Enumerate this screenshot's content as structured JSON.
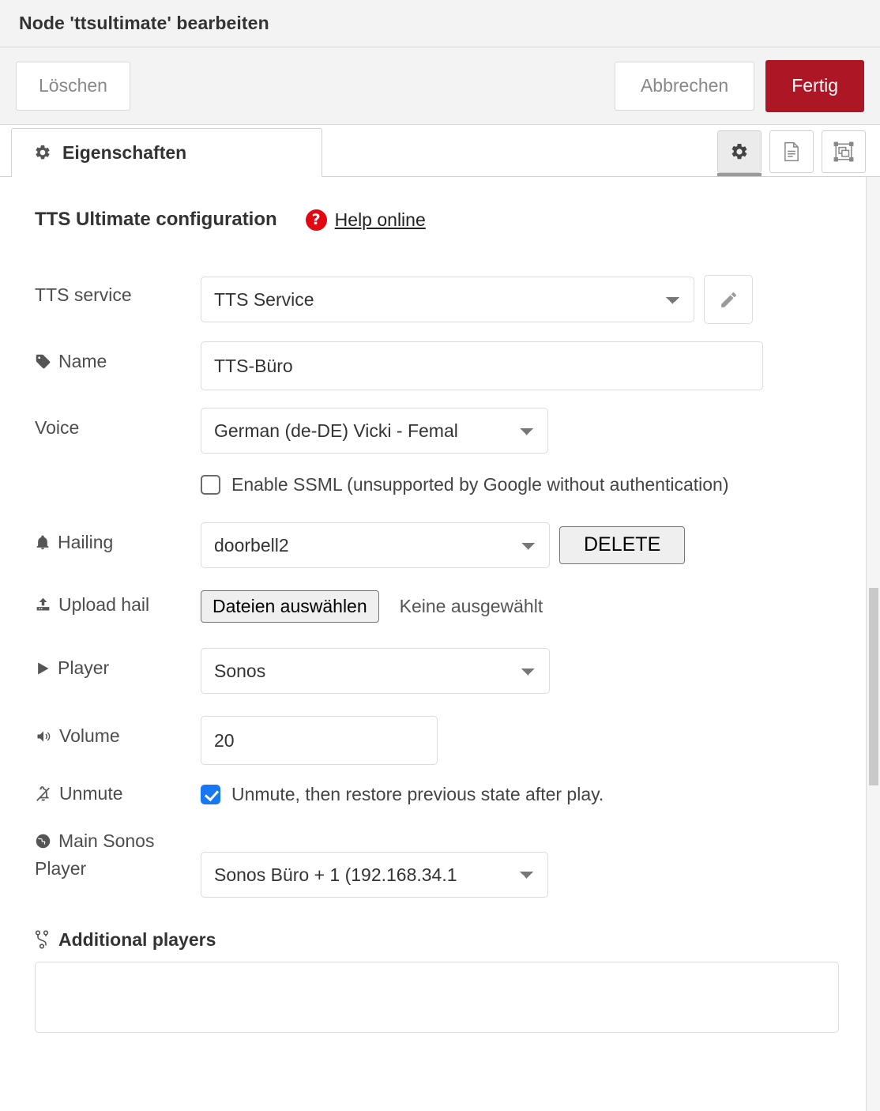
{
  "dialog": {
    "title": "Node 'ttsultimate' bearbeiten",
    "buttons": {
      "delete": "Löschen",
      "cancel": "Abbrechen",
      "done": "Fertig"
    }
  },
  "tabs": {
    "properties": {
      "label": "Eigenschaften",
      "icon": "gear-icon"
    },
    "side_icons": [
      {
        "name": "gear-icon",
        "active": true
      },
      {
        "name": "description-icon",
        "active": false
      },
      {
        "name": "appearance-icon",
        "active": false
      }
    ]
  },
  "form": {
    "section_title": "TTS Ultimate configuration",
    "help": {
      "label": "Help online",
      "badge": "?",
      "badge_color": "#e30613"
    },
    "tts_service": {
      "label": "TTS service",
      "value": "TTS Service",
      "edit_icon": "pencil-icon"
    },
    "name": {
      "label": "Name",
      "icon": "tag-icon",
      "value": "TTS-Büro",
      "placeholder": ""
    },
    "voice": {
      "label": "Voice",
      "value": "German (de-DE) Vicki - Femal"
    },
    "ssml": {
      "label": "Enable SSML (unsupported by Google without authentication)",
      "checked": false
    },
    "hailing": {
      "label": "Hailing",
      "icon": "bell-icon",
      "value": "doorbell2",
      "delete_button": "DELETE"
    },
    "upload_hail": {
      "label": "Upload hail",
      "icon": "upload-icon",
      "button": "Dateien auswählen",
      "status": "Keine ausgewählt"
    },
    "player": {
      "label": "Player",
      "icon": "play-icon",
      "value": "Sonos"
    },
    "volume": {
      "label": "Volume",
      "icon": "volume-icon",
      "value": "20",
      "placeholder": ""
    },
    "unmute": {
      "label": "Unmute",
      "icon": "bell-slash-icon",
      "checkbox_label": "Unmute, then restore previous state after play.",
      "checked": true
    },
    "main_sonos_player": {
      "label_line1": "Main Sonos",
      "label_line2": "Player",
      "icon": "globe-icon",
      "value": "Sonos Büro + 1 (192.168.34.1"
    },
    "additional_players": {
      "label": "Additional players",
      "icon": "code-branch-icon",
      "value": "",
      "placeholder": ""
    }
  },
  "colors": {
    "accent_red": "#ad1625",
    "help_red": "#e30613",
    "checkbox_blue": "#1877f2",
    "header_bg": "#f3f3f3",
    "border": "#d8d8d8"
  }
}
